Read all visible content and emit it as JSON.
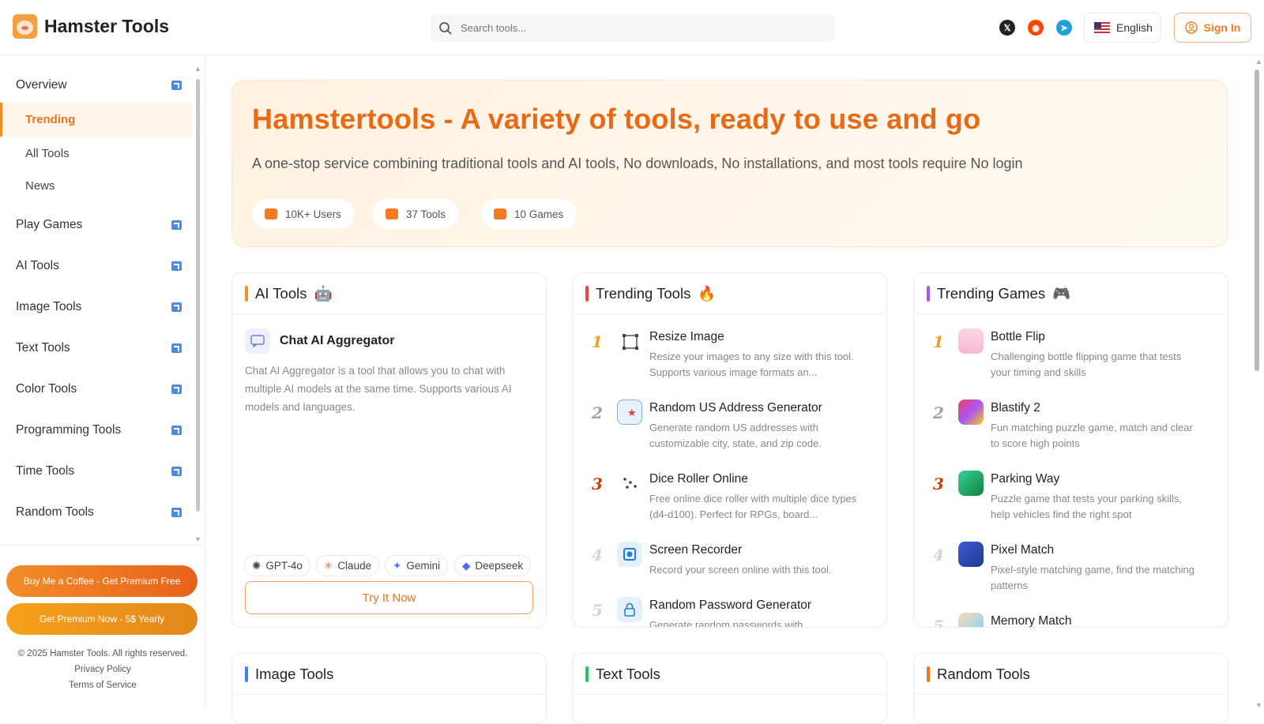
{
  "header": {
    "logo_text": "Hamster Tools",
    "search_placeholder": "Search tools...",
    "social": [
      {
        "name": "X",
        "glyph": "𝕏",
        "color": "#222222"
      },
      {
        "name": "Reddit",
        "glyph": "◉",
        "color": "#ff4500"
      },
      {
        "name": "Telegram",
        "glyph": "➤",
        "color": "#229ed9"
      }
    ],
    "language": "English",
    "sign_in": "Sign In"
  },
  "sidebar": {
    "overview": "Overview",
    "trending": "Trending",
    "all_tools": "All Tools",
    "news": "News",
    "items": [
      "Play Games",
      "AI Tools",
      "Image Tools",
      "Text Tools",
      "Color Tools",
      "Programming Tools",
      "Time Tools",
      "Random Tools"
    ],
    "coffee_button": "Buy Me a Coffee - Get Premium Free",
    "premium_button": "Get Premium Now - 5$ Yearly",
    "copyright": "© 2025 Hamster Tools. All rights reserved.",
    "privacy": "Privacy Policy",
    "terms": "Terms of Service"
  },
  "hero": {
    "title": "Hamstertools - A variety of tools, ready to use and go",
    "subtitle": "A one-stop service combining traditional tools and AI tools, No downloads, No installations, and most tools require No login",
    "stats": [
      "10K+ Users",
      "37 Tools",
      "10 Games"
    ]
  },
  "ai_card": {
    "title": "AI Tools",
    "emoji": "🤖",
    "tool_name": "Chat AI Aggregator",
    "tool_desc": "Chat AI Aggregator is a tool that allows you to chat with multiple AI models at the same time. Supports various AI models and languages.",
    "tags": [
      "GPT-4o",
      "Claude",
      "Gemini",
      "Deepseek"
    ],
    "try_button": "Try It Now"
  },
  "trending_tools": {
    "title": "Trending Tools",
    "emoji": "🔥",
    "items": [
      {
        "rank": "1",
        "title": "Resize Image",
        "desc": "Resize your images to any size with this tool. Supports various image formats an..."
      },
      {
        "rank": "2",
        "title": "Random US Address Generator",
        "desc": "Generate random US addresses with customizable city, state, and zip code."
      },
      {
        "rank": "3",
        "title": "Dice Roller Online",
        "desc": "Free online dice roller with multiple dice types (d4-d100). Perfect for RPGs, board..."
      },
      {
        "rank": "4",
        "title": "Screen Recorder",
        "desc": "Record your screen online with this tool."
      },
      {
        "rank": "5",
        "title": "Random Password Generator",
        "desc": "Generate random passwords with"
      }
    ]
  },
  "trending_games": {
    "title": "Trending Games",
    "emoji": "🎮",
    "items": [
      {
        "rank": "1",
        "title": "Bottle Flip",
        "desc": "Challenging bottle flipping game that tests your timing and skills"
      },
      {
        "rank": "2",
        "title": "Blastify 2",
        "desc": "Fun matching puzzle game, match and clear to score high points"
      },
      {
        "rank": "3",
        "title": "Parking Way",
        "desc": "Puzzle game that tests your parking skills, help vehicles find the right spot"
      },
      {
        "rank": "4",
        "title": "Pixel Match",
        "desc": "Pixel-style matching game, find the matching patterns"
      },
      {
        "rank": "5",
        "title": "Memory Match",
        "desc": ""
      }
    ]
  },
  "bottom_cards": [
    "Image Tools",
    "Text Tools",
    "Random Tools"
  ]
}
